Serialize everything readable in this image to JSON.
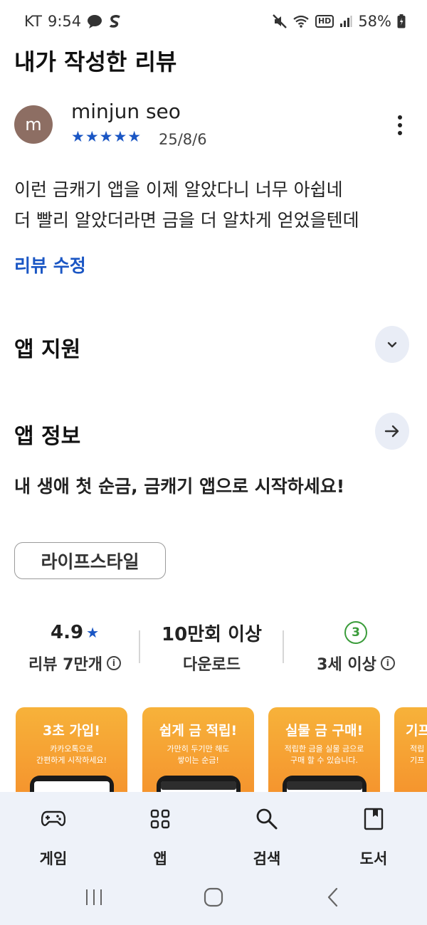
{
  "status_bar": {
    "carrier": "KT",
    "time": "9:54",
    "battery": "58%",
    "hd_label": "HD"
  },
  "page": {
    "title": "내가 작성한 리뷰"
  },
  "review": {
    "avatar_initial": "m",
    "author": "minjun seo",
    "stars_text": "★★★★★",
    "rating": 5,
    "date": "25/8/6",
    "text_line1": "이런 금캐기 앱을 이제 알았다니 너무 아쉽네",
    "text_line2": "더 빨리 알았더라면 금을 더 알차게 얻었을텐데",
    "edit_label": "리뷰 수정"
  },
  "sections": {
    "support_title": "앱 지원",
    "info_title": "앱 정보"
  },
  "app_info": {
    "description": "내 생애 첫 순금, 금캐기 앱으로 시작하세요!",
    "category": "라이프스타일",
    "rating_value": "4.9",
    "rating_label": "리뷰 7만개",
    "downloads_value": "10만회 이상",
    "downloads_label": "다운로드",
    "age_value": "3",
    "age_label": "3세 이상"
  },
  "screenshots": [
    {
      "title": "3초 가입!",
      "sub1": "카카오톡으로",
      "sub2": "간편하게 시작하세요!"
    },
    {
      "title": "쉽게 금 적립!",
      "sub1": "가만히 두기만 해도",
      "sub2": "쌓이는 순금!"
    },
    {
      "title": "실물 금 구매!",
      "sub1": "적립한 금을 실물 금으로",
      "sub2": "구매 할 수 있습니다."
    },
    {
      "title": "기프",
      "sub1": "적립",
      "sub2": "기프"
    }
  ],
  "bottom_nav": {
    "games": "게임",
    "apps": "앱",
    "search": "검색",
    "books": "도서"
  },
  "colors": {
    "accent_blue": "#1a56c4",
    "age_green": "#3a9c3a",
    "screenshot_orange": "#f48b2a",
    "nav_bg": "#eef2f9"
  },
  "icons": {
    "status_left": [
      "chat-bubble-icon",
      "s-app-icon"
    ],
    "status_right": [
      "mute-icon",
      "wifi-icon",
      "hd-icon",
      "signal-icon",
      "battery-icon"
    ],
    "more": "more-vert-icon",
    "support": "chevron-down-icon",
    "info": "arrow-right-icon",
    "nav": [
      "gamepad-icon",
      "apps-grid-icon",
      "search-icon",
      "book-icon"
    ],
    "system": [
      "recents-icon",
      "home-icon",
      "back-icon"
    ]
  }
}
